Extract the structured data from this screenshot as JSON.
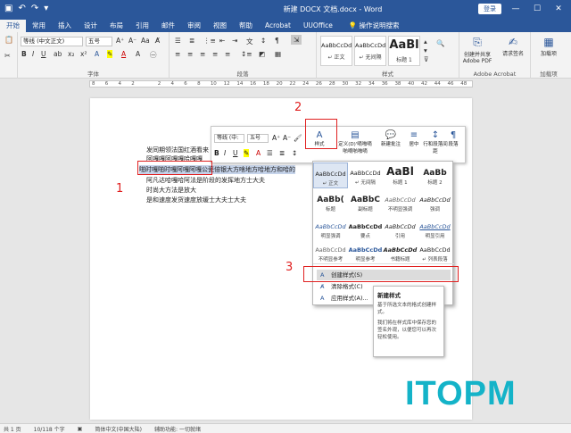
{
  "window": {
    "title": "新建 DOCX 文档.docx - Word",
    "login": "登录",
    "icons": [
      "save-icon",
      "undo-icon",
      "redo-icon",
      "customize-icon"
    ]
  },
  "tabs": [
    "开始",
    "常用",
    "插入",
    "设计",
    "布局",
    "引用",
    "邮件",
    "审阅",
    "视图",
    "帮助",
    "Acrobat",
    "UUOffice"
  ],
  "search": "操作说明搜索",
  "ribbon": {
    "clipboard_label": "剪贴板",
    "font_name": "等线 (中文正文)",
    "font_size": "五号",
    "font_label": "字体",
    "paragraph_label": "段落",
    "styles_label": "样式",
    "styles": [
      {
        "sample": "AaBbCcDd",
        "name": "↵ 正文"
      },
      {
        "sample": "AaBbCcDd",
        "name": "↵ 无间隔"
      },
      {
        "sample": "AaBl",
        "name": "标题 1"
      }
    ],
    "acrobat_btn1": "创建并共享 Adobe PDF",
    "acrobat_btn2": "请求签名",
    "acrobat_label": "Adobe Acrobat",
    "addin_btn": "加载项",
    "addin_label": "加载项"
  },
  "ruler_numbers": [
    "8",
    "6",
    "4",
    "2",
    "",
    "2",
    "4",
    "6",
    "8",
    "10",
    "12",
    "14",
    "16",
    "18",
    "20",
    "22",
    "24",
    "26",
    "28",
    "30",
    "32",
    "34",
    "36",
    "38",
    "40",
    "42",
    "44",
    "46",
    "48"
  ],
  "document": {
    "lines": [
      "发同期领法国红酒看来",
      "阿嘎嘎阿嘎嘎哈嘎嘎",
      "啪时嘎啪时嘎阿嘎阿嘎公瓷倍银大方啥地方哈地方和哈的",
      "阿凡达哈嘎哈阿法是阶段的发挥地方士大夫",
      "时尚大方法是放大",
      "是和速度发货速度放缓士大夫士大夫"
    ]
  },
  "mini_toolbar": {
    "font_name": "等线 (中:",
    "font_size": "五号",
    "styles_btn": "样式",
    "custom_btn": "定义(D)'嘀啪嘀啪嘀啪啪嘀",
    "new_comment": "新建批注",
    "center": "居中",
    "line_spacing": "行和段落间距",
    "paragraph": "段落"
  },
  "gallery": {
    "rows": [
      [
        {
          "sample": "AaBbCcDd",
          "name": "↵ 正文"
        },
        {
          "sample": "AaBbCcDd",
          "name": "↵ 无间隔"
        },
        {
          "sample": "AaBl",
          "name": "标题 1"
        },
        {
          "sample": "AaBb",
          "name": "标题 2"
        }
      ],
      [
        {
          "sample": "AaBb(",
          "name": "标题"
        },
        {
          "sample": "AaBbC",
          "name": "副标题"
        },
        {
          "sample": "AaBbCcDd",
          "name": "不明显强调"
        },
        {
          "sample": "AaBbCcDd",
          "name": "强调"
        }
      ],
      [
        {
          "sample": "AaBbCcDd",
          "name": "明显强调"
        },
        {
          "sample": "AaBbCcDd",
          "name": "要点"
        },
        {
          "sample": "AaBbCcDd",
          "name": "引用"
        },
        {
          "sample": "AaBbCcDd",
          "name": "明显引用"
        }
      ],
      [
        {
          "sample": "AaBbCcDd",
          "name": "不明显参考"
        },
        {
          "sample": "AaBbCcDd",
          "name": "明显参考"
        },
        {
          "sample": "AaBbCcDd",
          "name": "书籍标题"
        },
        {
          "sample": "AaBbCcDd",
          "name": "↵ 列表段落"
        }
      ]
    ],
    "menu": [
      {
        "icon": "create-style-icon",
        "label": "创建样式(S)"
      },
      {
        "icon": "clear-format-icon",
        "label": "清除格式(C)"
      },
      {
        "icon": "apply-style-icon",
        "label": "应用样式(A)..."
      }
    ]
  },
  "tooltip": {
    "title": "新建样式",
    "p1": "基于所选文本的格式创建样式。",
    "p2": "我们将在样式库中保存您的签名外观，以便您可以再次轻松使用。"
  },
  "annotations": [
    "1",
    "2",
    "3"
  ],
  "watermark": "ITOPM",
  "status": {
    "page": "共 1 页",
    "words": "10/118 个字",
    "lang": "简体中文(中国大陆)",
    "accessibility": "辅助功能: 一切就绪"
  },
  "colors": {
    "accent": "#2b579a",
    "annotation": "#e02020",
    "watermark": "#14b3c8"
  }
}
